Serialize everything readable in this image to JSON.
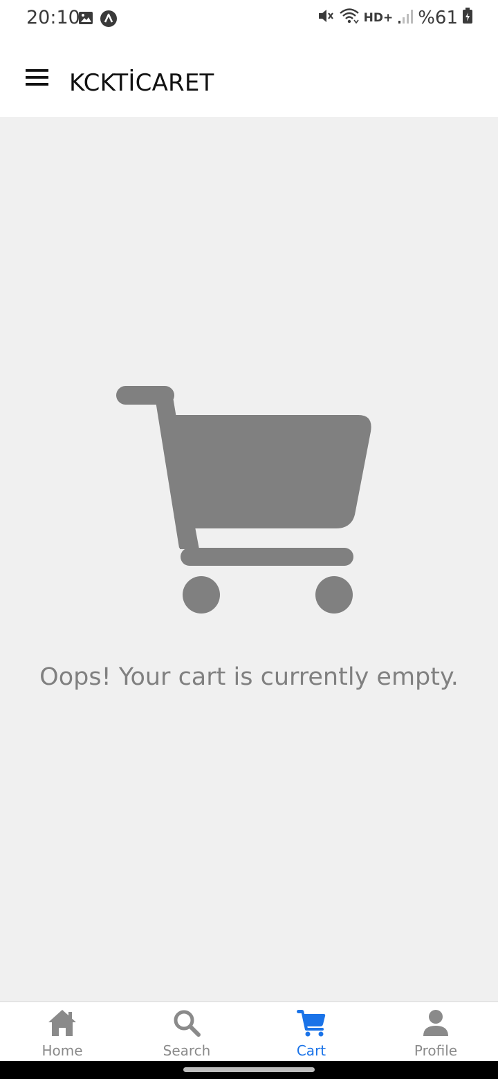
{
  "status_bar": {
    "time": "20:10",
    "network": "HD+",
    "battery": "%61",
    "icons": [
      "image-icon",
      "android-auto-icon",
      "mute-icon",
      "wifi-icon",
      "signal-icon",
      "battery-icon"
    ]
  },
  "app_bar": {
    "title": "KCKTİCARET",
    "menu_icon": "hamburger-menu-icon"
  },
  "content": {
    "empty_message": "Oops! Your cart is currently empty.",
    "illustration_icon": "shopping-cart-icon",
    "illustration_color": "#808080"
  },
  "bottom_nav": {
    "active_color": "#1a73e8",
    "inactive_color": "#8a8a8a",
    "items": [
      {
        "label": "Home",
        "icon": "home-icon",
        "active": false
      },
      {
        "label": "Search",
        "icon": "search-icon",
        "active": false
      },
      {
        "label": "Cart",
        "icon": "cart-icon",
        "active": true
      },
      {
        "label": "Profile",
        "icon": "profile-icon",
        "active": false
      }
    ]
  }
}
